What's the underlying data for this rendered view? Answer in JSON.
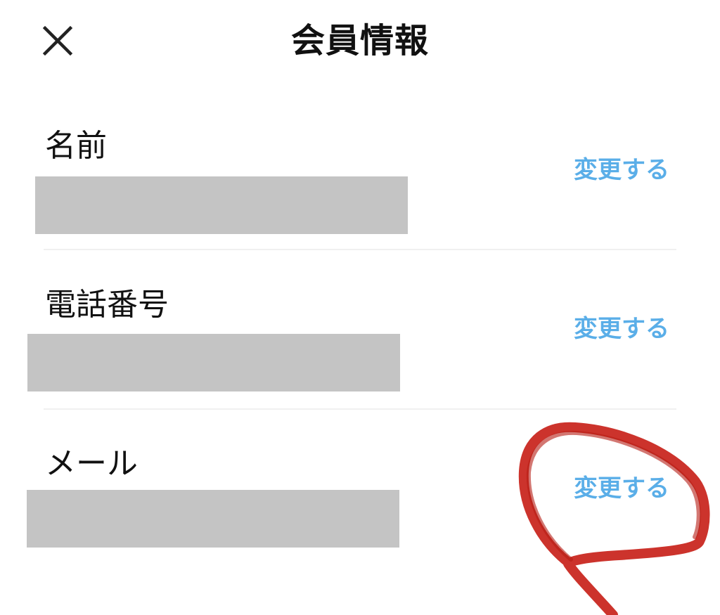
{
  "header": {
    "title": "会員情報",
    "close_icon": "close-icon"
  },
  "rows": [
    {
      "label": "名前",
      "value": "",
      "action": "変更する"
    },
    {
      "label": "電話番号",
      "value": "",
      "action": "変更する"
    },
    {
      "label": "メール",
      "value": "",
      "action": "変更する"
    }
  ],
  "colors": {
    "link": "#5aaee8",
    "redaction": "#c4c4c4",
    "annotation": "#c8221a",
    "divider": "#f0f0f0"
  }
}
